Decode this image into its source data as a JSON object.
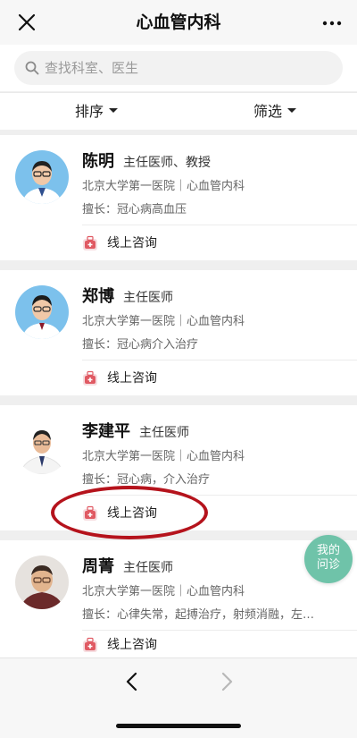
{
  "header": {
    "title": "心血管内科",
    "close_icon": "close-icon",
    "more_icon": "more-dots-icon"
  },
  "search": {
    "placeholder": "查找科室、医生",
    "icon": "search-icon"
  },
  "filters": {
    "sort_label": "排序",
    "filter_label": "筛选"
  },
  "doctors": [
    {
      "name": "陈明",
      "title": "主任医师、教授",
      "hospital": "北京大学第一医院｜心血管内科",
      "specialty": "擅长：冠心病高血压",
      "consult_label": "线上咨询"
    },
    {
      "name": "郑博",
      "title": "主任医师",
      "hospital": "北京大学第一医院｜心血管内科",
      "specialty": "擅长：冠心病介入治疗",
      "consult_label": "线上咨询"
    },
    {
      "name": "李建平",
      "title": "主任医师",
      "hospital": "北京大学第一医院｜心血管内科",
      "specialty": "擅长：冠心病，介入治疗",
      "consult_label": "线上咨询"
    },
    {
      "name": "周菁",
      "title": "主任医师",
      "hospital": "北京大学第一医院｜心血管内科",
      "specialty": "擅长：心律失常，起搏治疗，射频消融，左…",
      "consult_label": "线上咨询"
    }
  ],
  "fab": {
    "line1": "我的",
    "line2": "问诊",
    "color": "#6fc3a9"
  },
  "bottom_nav": {
    "back_icon": "chevron-left-icon",
    "forward_icon": "chevron-right-icon"
  },
  "colors": {
    "highlight_oval": "#b5131c",
    "consult_icon": "#e05a63"
  }
}
